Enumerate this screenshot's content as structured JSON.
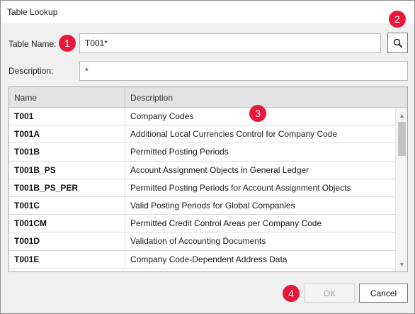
{
  "window": {
    "title": "Table Lookup"
  },
  "form": {
    "table_name_label": "Table Name:",
    "table_name_value": "T001*",
    "description_label": "Description:",
    "description_value": "*",
    "search_icon": "search-icon"
  },
  "grid": {
    "columns": [
      "Name",
      "Description"
    ],
    "rows": [
      {
        "name": "T001",
        "description": "Company Codes"
      },
      {
        "name": "T001A",
        "description": "Additional Local Currencies Control for Company Code"
      },
      {
        "name": "T001B",
        "description": "Permitted Posting Periods"
      },
      {
        "name": "T001B_PS",
        "description": "Account Assignment Objects in General Ledger"
      },
      {
        "name": "T001B_PS_PER",
        "description": "Permitted Posting Periods for Account Assignment Objects"
      },
      {
        "name": "T001C",
        "description": "Valid Posting Periods for Global Companies"
      },
      {
        "name": "T001CM",
        "description": "Permitted Credit Control Areas per Company Code"
      },
      {
        "name": "T001D",
        "description": "Validation of Accounting Documents"
      },
      {
        "name": "T001E",
        "description": "Company Code-Dependent Address Data"
      }
    ]
  },
  "buttons": {
    "ok": "OK",
    "cancel": "Cancel"
  },
  "badges": [
    "1",
    "2",
    "3",
    "4"
  ],
  "colors": {
    "badge": "#e8183a",
    "header_bg": "#e3e3e3",
    "dialog_bg": "#f0f0f0"
  }
}
